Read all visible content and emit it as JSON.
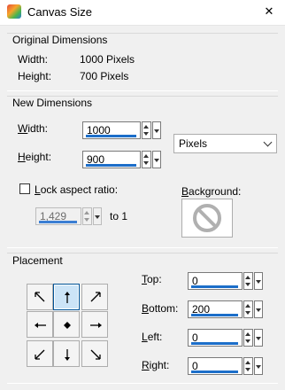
{
  "window": {
    "title": "Canvas Size",
    "close_glyph": "✕"
  },
  "original": {
    "title": "Original Dimensions",
    "width_label": "Width:",
    "width_value": "1000 Pixels",
    "height_label": "Height:",
    "height_value": "700 Pixels"
  },
  "new_dims": {
    "title": "New Dimensions",
    "width_label_u": "W",
    "width_label_rest": "idth:",
    "width_value": "1000",
    "height_label_u": "H",
    "height_label_rest": "eight:",
    "height_value": "900",
    "units": "Pixels",
    "lock_label_u": "L",
    "lock_label_rest": "ock aspect ratio:",
    "lock_checked": false,
    "ratio_value": "1,429",
    "ratio_suffix": "to 1",
    "background_label_u": "B",
    "background_label_rest": "ackground:",
    "background_icon": "no-symbol-icon"
  },
  "placement": {
    "title": "Placement",
    "selected": "top-center",
    "buttons": [
      "top-left",
      "top-center",
      "top-right",
      "middle-left",
      "center",
      "middle-right",
      "bottom-left",
      "bottom-center",
      "bottom-right"
    ],
    "top_label_u": "T",
    "top_label_rest": "op:",
    "top_value": "0",
    "bottom_label_u": "B",
    "bottom_label_rest": "ottom:",
    "bottom_value": "200",
    "left_label_u": "L",
    "left_label_rest": "eft:",
    "left_value": "0",
    "right_label_u": "R",
    "right_label_rest": "ight:",
    "right_value": "0"
  }
}
